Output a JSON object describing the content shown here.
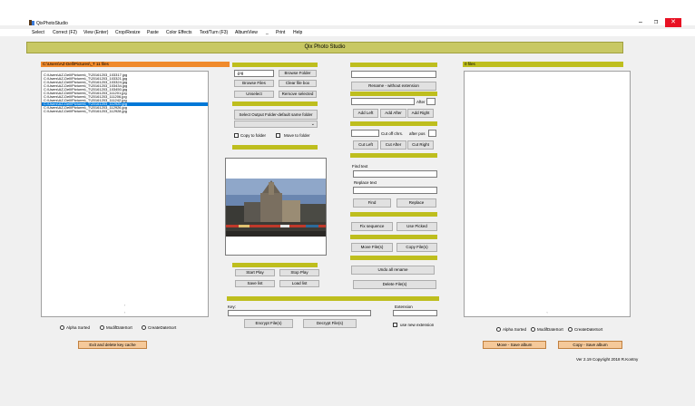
{
  "window": {
    "title": "QixPhotoStudio",
    "min": "–",
    "max": "❐",
    "close": "✕"
  },
  "menu": [
    "Select",
    "Correct (F2)",
    "View (Enter)",
    "Crop/Resize",
    "Paste",
    "Color Effects",
    "Text/Turn (F3)",
    "AlbumView",
    "_",
    "Print",
    "Help"
  ],
  "header": {
    "title": "Qix Photo Studio"
  },
  "left_panel": {
    "path_label": "C:\\Users\\AZ-Dell\\Pictures\\_T  11 files",
    "files": [
      "C:\\Users\\AZ-Dell\\Pictures\\_T\\20161203_103317.jpg",
      "C:\\Users\\AZ-Dell\\Pictures\\_T\\20161203_103321.jpg",
      "C:\\Users\\AZ-Dell\\Pictures\\_T\\20161203_103324.jpg",
      "C:\\Users\\AZ-Dell\\Pictures\\_T\\20161203_103434.jpg",
      "C:\\Users\\AZ-Dell\\Pictures\\_T\\20161203_103450.jpg",
      "C:\\Users\\AZ-Dell\\Pictures\\_T\\20161203_111201.jpg",
      "C:\\Users\\AZ-Dell\\Pictures\\_T\\20161203_111206.jpg",
      "C:\\Users\\AZ-Dell\\Pictures\\_T\\20161203_111242.jpg",
      "C:\\Users\\AZ-Dell\\Pictures\\_T\\20161203_112920.jpg",
      "C:\\Users\\AZ-Dell\\Pictures\\_T\\20161203_112926.jpg",
      "C:\\Users\\AZ-Dell\\Pictures\\_T\\20161203_112928.jpg"
    ],
    "selected_index": 8,
    "sort_alpha": "Alpha Sorted",
    "sort_modif": "ModifDateSort",
    "sort_create": "CreateDateSort",
    "exit_button": "Exit and delete key cache"
  },
  "middle_panel": {
    "ext_value": ".jpg",
    "browse_folder": "Browse Folder",
    "browse_files": "Browse Files",
    "clear_file_box": "Clear file box",
    "unselect": "Unselect",
    "remove_selected": "Remove selected",
    "select_output": "Select Output Folder-default same folder",
    "copy_to_folder": "Copy to folder",
    "move_to_folder": "Move to folder",
    "start_play": "Start Play",
    "stop_play": "Stop Play",
    "save_list": "Save list",
    "load_list": "Load list",
    "key_label": "Key:",
    "encrypt": "Encrypt File(s)",
    "decrypt": "Decrypt File(s)"
  },
  "rename_panel": {
    "rename_without_ext": "Rename - without extension",
    "after_label": "After",
    "add_left": "Add Left",
    "add_after": "Add After",
    "add_right": "Add Right",
    "cut_off_chrs": "Cut off chrs.",
    "after_pos": "after pos",
    "cut_left": "Cut Left",
    "cut_after": "Cut After",
    "cut_right": "Cut Right",
    "find_text_label": "Find text",
    "replace_text_label": "Replace text",
    "find": "Find",
    "replace": "Replace",
    "fix_sequence": "Fix sequence",
    "use_picked": "Use Picked",
    "move_files": "Move File(s)",
    "copy_files": "Copy File(s)",
    "undo_rename": "Undo all rename",
    "delete_files": "Delete File(s)",
    "extension_label": "Extension",
    "use_new_extension": "use new extension"
  },
  "right_panel": {
    "files_label": "0 files",
    "sort_alpha": "Alpha Sorted",
    "sort_modif": "ModifDateSort",
    "sort_create": "CreateDateSort",
    "move_save_album": "Move - Save album",
    "copy_save_album": "Copy - Save album",
    "version": "Ver 2.19 Copyright 2018 R.Kontny"
  },
  "colors": {
    "olive": "#bebe1e",
    "orange": "#f08a2c",
    "header": "#c8c864",
    "accent_button": "#f5c99a",
    "selection": "#0078d7"
  },
  "icons": {
    "dropdown": "chevron-down-icon",
    "app": "app-icon"
  }
}
